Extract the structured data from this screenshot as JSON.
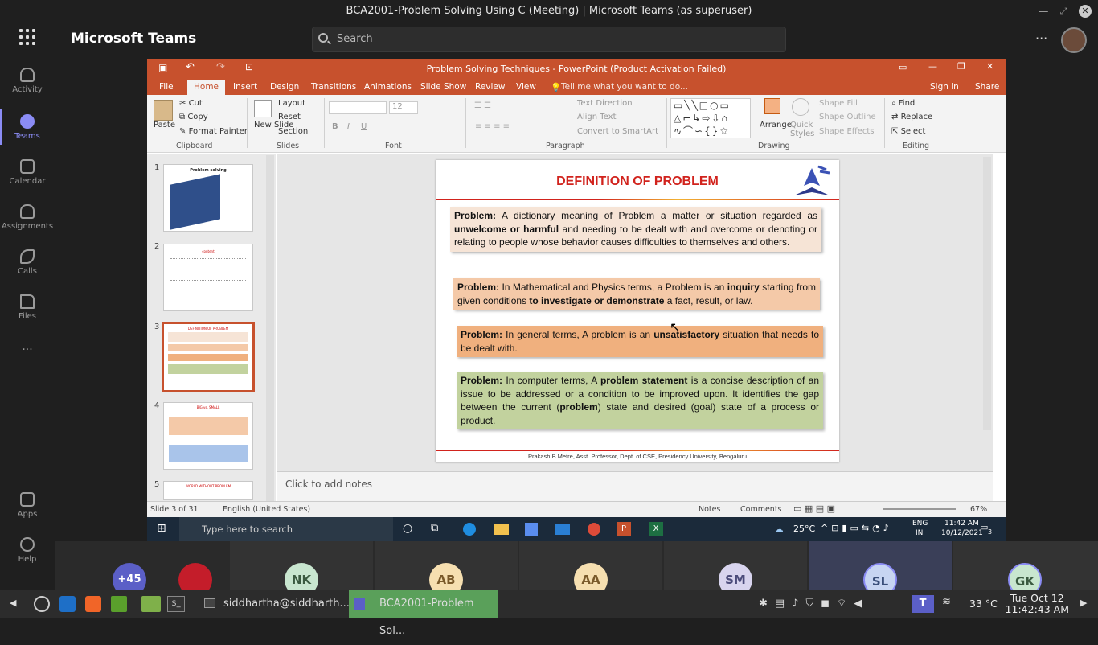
{
  "window": {
    "title": "BCA2001-Problem Solving Using C (Meeting) | Microsoft Teams (as superuser)"
  },
  "teams": {
    "app_name": "Microsoft Teams",
    "search_placeholder": "Search",
    "more": "···",
    "rail": [
      {
        "label": "Activity",
        "icon": "bell-icon"
      },
      {
        "label": "Teams",
        "icon": "teams-icon",
        "active": true
      },
      {
        "label": "Calendar",
        "icon": "calendar-icon"
      },
      {
        "label": "Assignments",
        "icon": "assignments-icon"
      },
      {
        "label": "Calls",
        "icon": "phone-icon"
      },
      {
        "label": "Files",
        "icon": "file-icon"
      },
      {
        "label": "···",
        "icon": "more-icon"
      },
      {
        "label": "Apps",
        "icon": "apps-icon"
      },
      {
        "label": "Help",
        "icon": "help-icon"
      }
    ]
  },
  "ppt": {
    "title": "Problem Solving Techniques - PowerPoint (Product Activation Failed)",
    "tabs": [
      "File",
      "Home",
      "Insert",
      "Design",
      "Transitions",
      "Animations",
      "Slide Show",
      "Review",
      "View"
    ],
    "tell_me": "Tell me what you want to do...",
    "sign_in": "Sign in",
    "share": "Share",
    "ribbon": {
      "paste": "Paste",
      "cut": "Cut",
      "copy": "Copy",
      "format_painter": "Format Painter",
      "new_slide": "New Slide",
      "layout": "Layout",
      "reset": "Reset",
      "section": "Section",
      "font_size": "12",
      "text_direction": "Text Direction",
      "align_text": "Align Text",
      "convert_smartart": "Convert to SmartArt",
      "arrange": "Arrange",
      "quick_styles": "Quick Styles",
      "shape_fill": "Shape Fill",
      "shape_outline": "Shape Outline",
      "shape_effects": "Shape Effects",
      "find": "Find",
      "replace": "Replace",
      "select": "Select",
      "groups": [
        "Clipboard",
        "Slides",
        "Font",
        "Paragraph",
        "Drawing",
        "Editing"
      ]
    },
    "thumbnails": [
      {
        "num": "1",
        "title": "Problem solving"
      },
      {
        "num": "2",
        "title": "content"
      },
      {
        "num": "3",
        "title": "DEFINITION OF PROBLEM"
      },
      {
        "num": "4",
        "title": "BIG vs. SMALL"
      },
      {
        "num": "5",
        "title": "WORLD WITHOUT PROBLEM"
      }
    ],
    "notes_placeholder": "Click to add notes",
    "status": {
      "slide": "Slide 3 of 31",
      "language": "English (United States)",
      "notes": "Notes",
      "comments": "Comments",
      "zoom": "67%"
    },
    "slide": {
      "title": "DEFINITION OF PROBLEM",
      "footer": "Prakash B Metre, Asst. Professor, Dept. of CSE, Presidency University, Bengaluru",
      "boxes": [
        {
          "lead": "Problem:",
          "text": " A dictionary meaning of Problem a matter or situation regarded as ",
          "b2": "unwelcome or harmful",
          "text2": " and needing to be dealt with and overcome or denoting or relating to people whose behavior causes difficulties to themselves and others.",
          "bg": "#f6e4d6"
        },
        {
          "lead": "Problem:",
          "text": " In Mathematical and Physics terms, a Problem is an ",
          "b2": "inquiry",
          "text2": " starting from given conditions ",
          "b3": "to investigate or demonstrate",
          "text3": " a fact, result, or law.",
          "bg": "#f4c9a8"
        },
        {
          "lead": "Problem:",
          "text": " In general terms, A problem is an ",
          "b2": "unsatisfactory",
          "text2": " situation that needs to be dealt with.",
          "bg": "#f0b07e"
        },
        {
          "lead": "Problem:",
          "text": " In computer terms, A ",
          "b2": "problem statement",
          "text2": " is a concise description of an issue to be addressed or a condition to be improved upon. It identifies the gap between the current (",
          "b3": "problem",
          "text3": ") state and desired (goal) state of a process or product.",
          "bg": "#c2d29e"
        }
      ]
    }
  },
  "win_taskbar": {
    "search_placeholder": "Type here to search",
    "temp": "25°C",
    "lang": "ENG",
    "lang2": "IN",
    "time": "11:42 AM",
    "date": "10/12/2021",
    "notif": "3"
  },
  "participants": [
    {
      "initials": "+45",
      "color": "#5b5fc7"
    },
    {
      "initials": "",
      "color": "#c41d2a"
    },
    {
      "initials": "NK",
      "color": "#c8e6cf"
    },
    {
      "initials": "AB",
      "color": "#f6dfb0"
    },
    {
      "initials": "AA",
      "color": "#f6dfb0"
    },
    {
      "initials": "SM",
      "color": "#d8d4ee"
    },
    {
      "initials": "SL",
      "color": "#c7d5f2"
    },
    {
      "initials": "GK",
      "color": "#c8e6cf"
    }
  ],
  "linux": {
    "tasks": [
      "siddhartha@siddharth...",
      "BCA2001-Problem Sol..."
    ],
    "temp": "33 °C",
    "date": "Tue Oct 12",
    "time": "11:42:43 AM"
  }
}
